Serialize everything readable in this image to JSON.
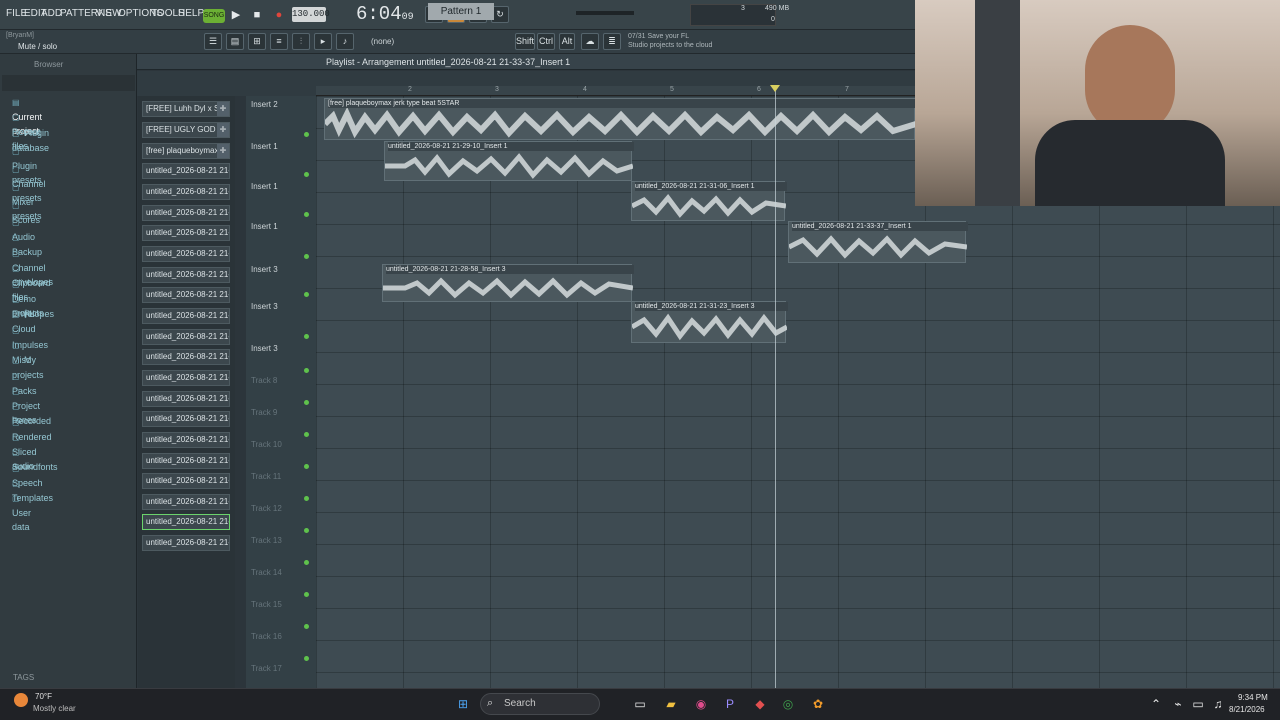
{
  "menu": [
    "FILE",
    "EDIT",
    "ADD",
    "PATTERNS",
    "VIEW",
    "OPTIONS",
    "TOOLS",
    "HELP"
  ],
  "transport": {
    "song": "SONG",
    "tempo": "130.000",
    "time_main": "6:04",
    "time_sub": "09",
    "cpu": "490 MB",
    "cpu_val": "3",
    "poly": "0"
  },
  "hint": {
    "user": "[BryanM]",
    "text": "Mute / solo"
  },
  "toolbar": {
    "pattern": "Pattern 1",
    "none": "(none)",
    "shift": "Shift",
    "ctrl": "Ctrl",
    "alt": "Alt",
    "cloud_line1": "07/31  Save your FL",
    "cloud_line2": "Studio projects to the cloud"
  },
  "browser": {
    "title": "Browser",
    "items": [
      "Current project",
      "Recent files",
      "Plugin database",
      "Plugin presets",
      "Channel presets",
      "Mixer presets",
      "Scores",
      "Audio",
      "Backup",
      "Channel envelopes",
      "Clipboard files",
      "Demo projects",
      "Envelopes",
      "FL Cloud",
      "Impulses",
      "Misc",
      "My projects",
      "Packs",
      "Project bones",
      "Recorded",
      "Rendered",
      "Sliced audio",
      "Soundfonts",
      "Speech",
      "Templates",
      "User data"
    ],
    "tags": "TAGS"
  },
  "channels": [
    "[FREE] Luhh Dyl x Sa..",
    "[FREE] UGLY GOD TYP..",
    "[free] plaqueboymax..",
    "untitled_2026-08-21 21-..",
    "untitled_2026-08-21 21-..",
    "untitled_2026-08-21 21-..",
    "untitled_2026-08-21 21-..",
    "untitled_2026-08-21 21-..",
    "untitled_2026-08-21 21-..",
    "untitled_2026-08-21 21-..",
    "untitled_2026-08-21 21-..",
    "untitled_2026-08-21 21-..",
    "untitled_2026-08-21 21-..",
    "untitled_2026-08-21 21-..",
    "untitled_2026-08-21 21-..",
    "untitled_2026-08-21 21-..",
    "untitled_2026-08-21 21-..",
    "untitled_2026-08-21 21-..",
    "untitled_2026-08-21 21-..",
    "untitled_2026-08-21 21-..",
    "untitled_2026-08-21 21-..",
    "untitled_2026-08-21 21-.."
  ],
  "playlist": {
    "title": "Playlist - Arrangement  untitled_2026-08-21 21-33-37_Insert 1",
    "bars": [
      "2",
      "3",
      "4",
      "5",
      "6",
      "7"
    ]
  },
  "tracks": [
    "Insert 2",
    "Insert 1",
    "Insert 1",
    "Insert 1",
    "Insert 3",
    "Insert 3",
    "Insert 3",
    "Track 8",
    "Track 9",
    "Track 10",
    "Track 11",
    "Track 12",
    "Track 13",
    "Track 14",
    "Track 15",
    "Track 16",
    "Track 17"
  ],
  "clips": [
    "[free] plaqueboymax  jerk type beat 5STAR",
    "untitled_2026-08-21 21-29-10_Insert 1",
    "untitled_2026-08-21 21-31-06_Insert 1",
    "untitled_2026-08-21 21-33-37_Insert 1",
    "untitled_2026-08-21 21-28-58_Insert 3",
    "untitled_2026-08-21 21-31-23_Insert 3"
  ],
  "taskbar": {
    "temp": "70°F",
    "weather": "Mostly clear",
    "search": "Search",
    "time": "9:34 PM",
    "date": "8/21/2026"
  }
}
